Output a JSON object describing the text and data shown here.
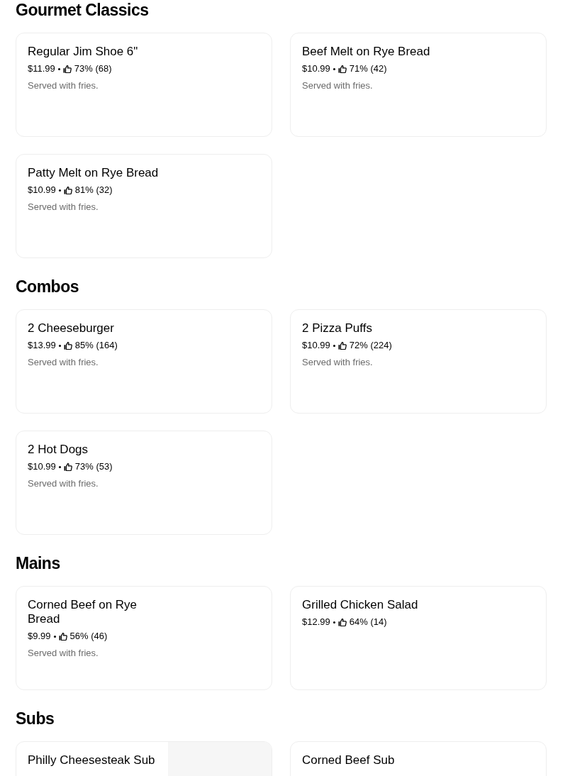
{
  "sections": [
    {
      "title": "Gourmet Classics",
      "items": [
        {
          "kind": "plain",
          "name": "Regular Jim Shoe 6\"",
          "price": "$11.99",
          "rating": "73% (68)",
          "description": "Served with fries."
        },
        {
          "kind": "plain",
          "name": "Beef Melt on Rye Bread",
          "price": "$10.99",
          "rating": "71% (42)",
          "description": "Served with fries."
        },
        {
          "kind": "plain",
          "name": "Patty Melt on Rye Bread",
          "price": "$10.99",
          "rating": "81% (32)",
          "description": "Served with fries."
        }
      ]
    },
    {
      "title": "Combos",
      "items": [
        {
          "kind": "plain",
          "name": "2 Cheeseburger",
          "price": "$13.99",
          "rating": "85% (164)",
          "description": "Served with fries."
        },
        {
          "kind": "plain",
          "name": "2 Pizza Puffs",
          "price": "$10.99",
          "rating": "72% (224)",
          "description": "Served with fries."
        },
        {
          "kind": "plain",
          "name": "2 Hot Dogs",
          "price": "$10.99",
          "rating": "73% (53)",
          "description": "Served with fries."
        }
      ]
    },
    {
      "title": "Mains",
      "items": [
        {
          "kind": "plain",
          "name": "Corned Beef on Rye Bread",
          "price": "$9.99",
          "rating": "56% (46)",
          "description": "Served with fries."
        },
        {
          "kind": "plain",
          "name": "Grilled Chicken Salad",
          "price": "$12.99",
          "rating": "64% (14)"
        }
      ]
    },
    {
      "title": "Subs",
      "items": [
        {
          "kind": "photo",
          "name": "Philly Cheesesteak Sub"
        },
        {
          "kind": "plain",
          "name": "Corned Beef Sub"
        }
      ]
    }
  ]
}
